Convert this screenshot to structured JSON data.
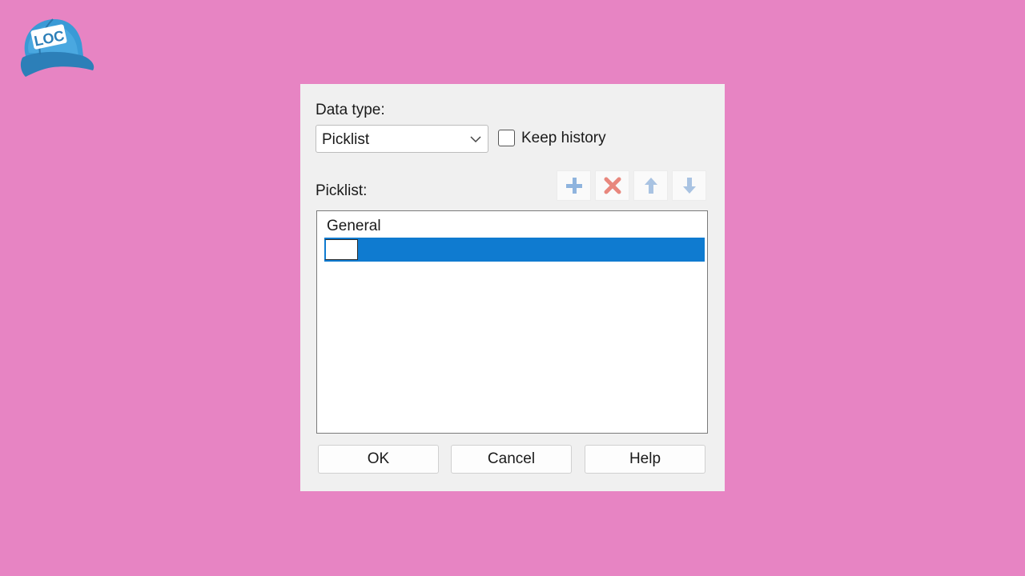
{
  "logo": {
    "text": "LOC",
    "cap_color": "#3a9ad6"
  },
  "dialog": {
    "data_type_label": "Data type:",
    "data_type_value": "Picklist",
    "keep_history_label": "Keep history",
    "keep_history_checked": false,
    "picklist_label": "Picklist:",
    "toolbar": {
      "add_icon": "plus-icon",
      "delete_icon": "delete-x-icon",
      "up_icon": "arrow-up-icon",
      "down_icon": "arrow-down-icon"
    },
    "list_items": [
      "General"
    ],
    "new_item_value": "",
    "buttons": {
      "ok": "OK",
      "cancel": "Cancel",
      "help": "Help"
    }
  },
  "colors": {
    "background": "#e784c3",
    "selection": "#0f7bd0",
    "dialog": "#f0f0f0"
  }
}
